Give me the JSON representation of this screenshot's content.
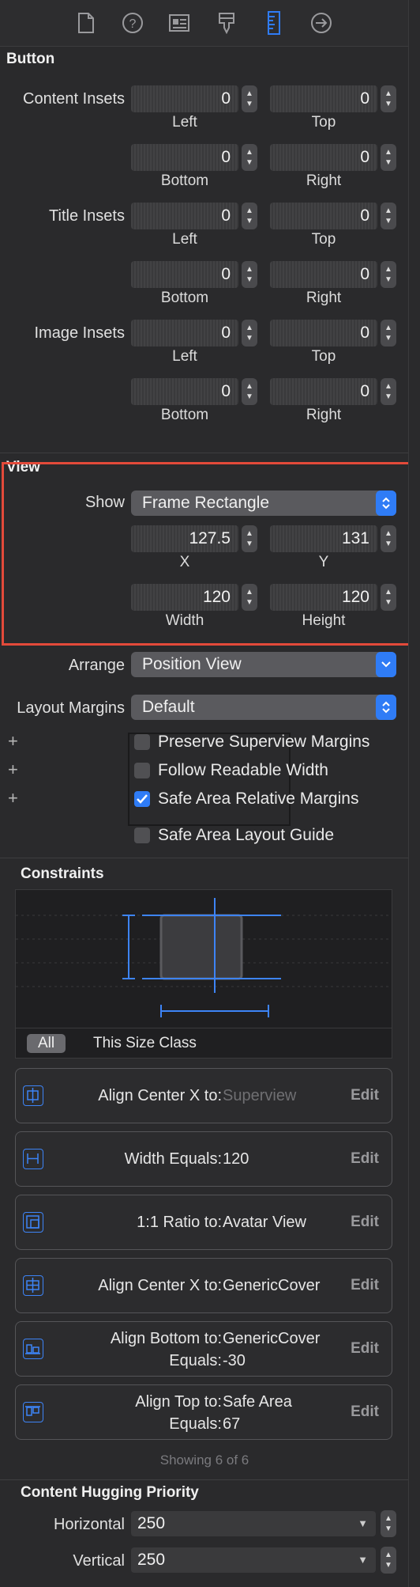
{
  "colors": {
    "accent": "#2f7cf6",
    "highlight": "#e34a3a",
    "background": "#2a2a2c"
  },
  "toolbar": {
    "icons": [
      "file-icon",
      "help-icon",
      "identity-icon",
      "attributes-icon",
      "size-ruler-icon",
      "connections-icon"
    ],
    "active": "size-ruler-icon"
  },
  "button": {
    "title": "Button",
    "content_insets": {
      "label": "Content Insets",
      "left": "0",
      "top": "0",
      "bottom": "0",
      "right": "0"
    },
    "title_insets": {
      "label": "Title Insets",
      "left": "0",
      "top": "0",
      "bottom": "0",
      "right": "0"
    },
    "image_insets": {
      "label": "Image Insets",
      "left": "0",
      "top": "0",
      "bottom": "0",
      "right": "0"
    },
    "sub": {
      "left": "Left",
      "top": "Top",
      "bottom": "Bottom",
      "right": "Right"
    }
  },
  "view": {
    "title": "View",
    "show_label": "Show",
    "show_value": "Frame Rectangle",
    "x": "127.5",
    "y": "131",
    "width": "120",
    "height": "120",
    "x_label": "X",
    "y_label": "Y",
    "width_label": "Width",
    "height_label": "Height",
    "arrange_label": "Arrange",
    "arrange_value": "Position View",
    "layout_margins_label": "Layout Margins",
    "layout_margins_value": "Default",
    "checkboxes": [
      {
        "label": "Preserve Superview Margins",
        "checked": false
      },
      {
        "label": "Follow Readable Width",
        "checked": false
      },
      {
        "label": "Safe Area Relative Margins",
        "checked": true
      },
      {
        "label": "Safe Area Layout Guide",
        "checked": false
      }
    ],
    "plus": "+"
  },
  "constraints": {
    "title": "Constraints",
    "filter_all": "All",
    "filter_size_class": "This Size Class",
    "items": [
      {
        "label": "Align Center X to:",
        "value": "Superview",
        "value2": "",
        "label2": "",
        "edit": "Edit",
        "icon": "align-center-x-icon"
      },
      {
        "label": "Width Equals:",
        "value": "120",
        "value2": "",
        "label2": "",
        "edit": "Edit",
        "icon": "width-constraint-icon"
      },
      {
        "label": "1:1 Ratio to:",
        "value": "Avatar View",
        "value2": "",
        "label2": "",
        "edit": "Edit",
        "icon": "aspect-ratio-icon"
      },
      {
        "label": "Align Center X to:",
        "value": "GenericCover",
        "value2": "",
        "label2": "",
        "edit": "Edit",
        "icon": "align-center-x-icon"
      },
      {
        "label": "Align Bottom to:",
        "value": "GenericCover",
        "label2": "Equals:",
        "value2": "-30",
        "edit": "Edit",
        "icon": "align-bottom-icon"
      },
      {
        "label": "Align Top to:",
        "value": "Safe Area",
        "label2": "Equals:",
        "value2": "67",
        "edit": "Edit",
        "icon": "align-top-icon"
      }
    ],
    "showing": "Showing 6 of 6"
  },
  "hugging": {
    "title": "Content Hugging Priority",
    "horizontal_label": "Horizontal",
    "horizontal_value": "250",
    "vertical_label": "Vertical",
    "vertical_value": "250"
  }
}
